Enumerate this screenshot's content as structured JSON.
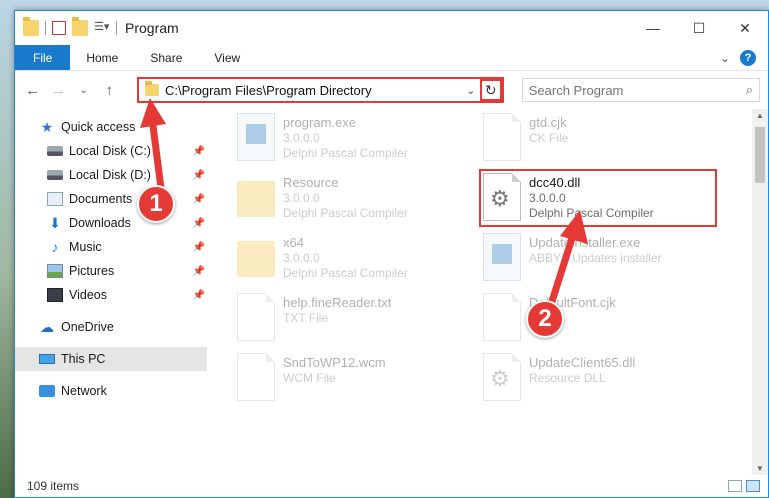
{
  "window": {
    "title": "Program",
    "minimize_glyph": "—",
    "maximize_glyph": "☐",
    "close_glyph": "✕"
  },
  "ribbon": {
    "tabs": [
      "File",
      "Home",
      "Share",
      "View"
    ]
  },
  "address": {
    "path": "C:\\Program Files\\Program Directory",
    "search_placeholder": "Search Program"
  },
  "nav": {
    "quick_access": "Quick access",
    "items": [
      "Local Disk (C:)",
      "Local Disk (D:)",
      "Documents",
      "Downloads",
      "Music",
      "Pictures",
      "Videos"
    ],
    "onedrive": "OneDrive",
    "this_pc": "This PC",
    "network": "Network"
  },
  "files": [
    {
      "name": "program.exe",
      "line2": "3.0.0.0",
      "line3": "Delphi Pascal Compiler",
      "icon": "exe-icon",
      "dim": true
    },
    {
      "name": "gtd.cjk",
      "line2": "CK File",
      "line3": "",
      "icon": "file-icon",
      "dim": true
    },
    {
      "name": "Resource",
      "line2": "3.0.0.0",
      "line3": "Delphi Pascal Compiler",
      "icon": "folder-icon",
      "dim": true
    },
    {
      "name": "dcc40.dll",
      "line2": "3.0.0.0",
      "line3": "Delphi Pascal Compiler",
      "icon": "dll-icon",
      "dim": false
    },
    {
      "name": "x64",
      "line2": "3.0.0.0",
      "line3": "Delphi Pascal Compiler",
      "icon": "folder-icon",
      "dim": true
    },
    {
      "name": "UpdateInstaller.exe",
      "line2": "ABBYY Updates installer",
      "line3": "",
      "icon": "exe-icon",
      "dim": true
    },
    {
      "name": "help.fineReader.txt",
      "line2": "TXT File",
      "line3": "",
      "icon": "file-icon",
      "dim": true
    },
    {
      "name": "DefaultFont.cjk",
      "line2": "",
      "line3": "",
      "icon": "file-icon",
      "dim": true
    },
    {
      "name": "SndToWP12.wcm",
      "line2": "WCM File",
      "line3": "",
      "icon": "file-icon",
      "dim": true
    },
    {
      "name": "UpdateClient65.dll",
      "line2": "Resource DLL",
      "line3": "",
      "icon": "dll-icon",
      "dim": true
    }
  ],
  "status": {
    "item_count": "109 items"
  },
  "annotations": {
    "step1": "1",
    "step2": "2",
    "color": "#e53935"
  }
}
